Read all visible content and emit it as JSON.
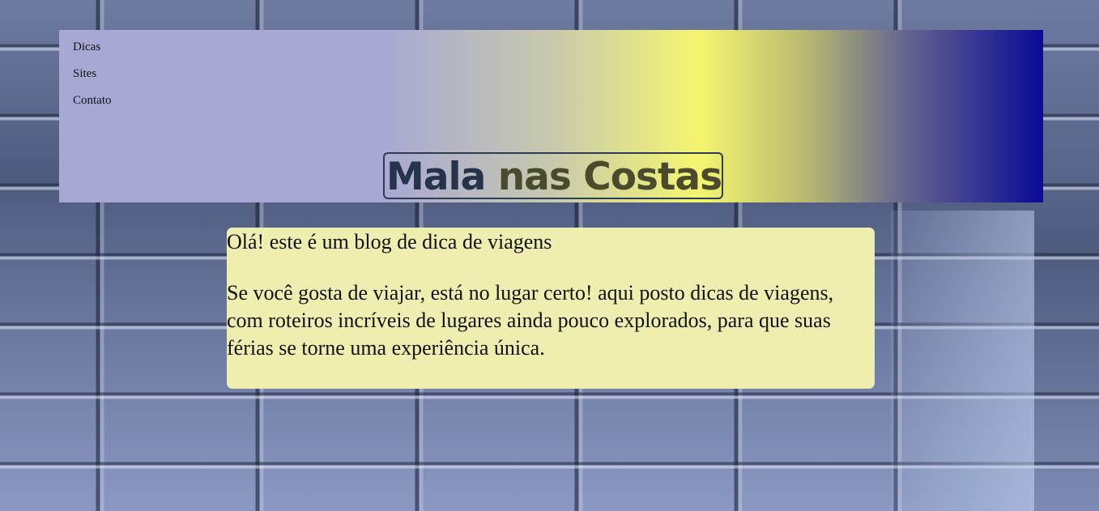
{
  "nav": {
    "items": [
      "Dicas",
      "Sites",
      "Contato"
    ]
  },
  "header": {
    "title_part1": "Mala",
    "title_part2": "nas Costas"
  },
  "main": {
    "intro": "Olá! este é um blog de dica de viagens",
    "paragraph": "Se você gosta de viajar, está no lugar certo! aqui posto dicas de viagens, com roteiros incríveis de lugares ainda pouco explorados, para que suas férias se torne uma experiência única."
  },
  "colors": {
    "header_gradient": [
      "#a8a8d4",
      "#f5f571",
      "#0a0a96"
    ],
    "card_background": "#eeeeb0",
    "title_primary": "#25344a",
    "title_secondary": "#4a4a2c"
  }
}
